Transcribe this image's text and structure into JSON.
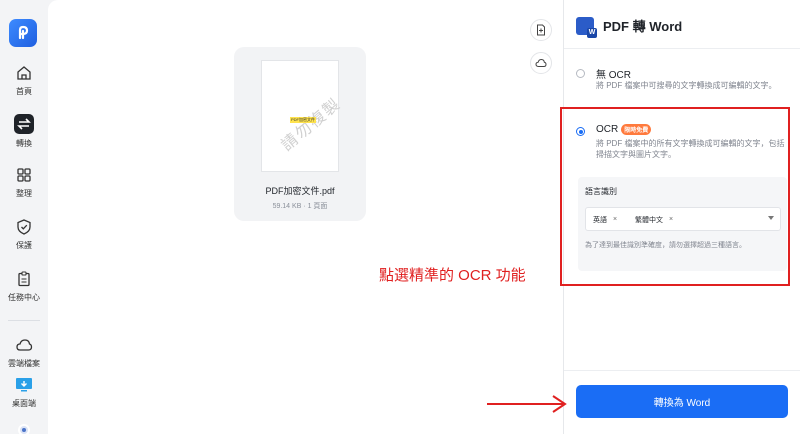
{
  "nav": {
    "items": [
      {
        "label": "首頁",
        "icon": "home-icon"
      },
      {
        "label": "轉換",
        "icon": "convert-icon"
      },
      {
        "label": "整理",
        "icon": "organize-icon"
      },
      {
        "label": "保護",
        "icon": "shield-icon"
      },
      {
        "label": "任務中心",
        "icon": "clipboard-icon"
      },
      {
        "label": "雲端檔案",
        "icon": "cloud-icon"
      },
      {
        "label": "桌面端",
        "icon": "desktop-icon"
      }
    ],
    "active": "轉換"
  },
  "file": {
    "name": "PDF加密文件.pdf",
    "meta": "59.14 KB · 1 頁面",
    "thumb_tag": "PDF加密文件",
    "watermark": "請勿複製"
  },
  "panel": {
    "title": "PDF 轉 Word",
    "options": [
      {
        "title": "無 OCR",
        "desc": "將 PDF 檔案中可搜尋的文字轉換成可編輯的文字。",
        "selected": false
      },
      {
        "title": "OCR",
        "badge": "限時免費",
        "desc": "將 PDF 檔案中的所有文字轉換成可編輯的文字，包括掃描文字與圖片文字。",
        "selected": true
      }
    ],
    "language": {
      "label": "語言識別",
      "chips": [
        "英語",
        "繁體中文"
      ],
      "note": "為了達到最佳識別準確度，請勿選擇超過三種語言。"
    },
    "convert_button": "轉換為 Word"
  },
  "annotation": {
    "text": "點選精準的 OCR 功能",
    "color": "#e02020"
  },
  "colors": {
    "accent": "#1a6df5",
    "badge": "#ff7a3d"
  }
}
